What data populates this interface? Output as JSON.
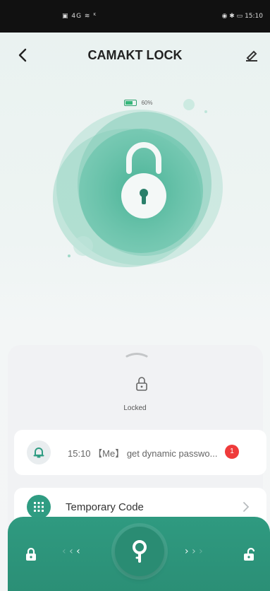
{
  "status_bar": {
    "left_icons": "▣ 4G ≋ ᴷ",
    "time": "15:10",
    "right_icons": "◉ ✱ ▭"
  },
  "header": {
    "title": "CAMAKT LOCK",
    "back_icon": "chevron-left-icon",
    "edit_icon": "pen-icon"
  },
  "battery": {
    "percent_label": "60%",
    "level": 0.6,
    "color": "#35b77a"
  },
  "lock_visual": {
    "icon": "padlock-icon",
    "accent": "#2f9c82"
  },
  "lock_status": {
    "label": "Locked",
    "icon": "small-lock-icon"
  },
  "notification": {
    "time": "15:10",
    "text": "15:10 【Me】 get dynamic passwo...",
    "badge_count": "1",
    "badge_color": "#ef3b3b"
  },
  "menu": {
    "temporary_code_label": "Temporary Code"
  },
  "bottom_bar": {
    "left_arrows": "‹ ‹ ‹",
    "right_arrows": "› › ›",
    "center_icon": "key-icon",
    "lock_icon": "lock-closed-icon",
    "unlock_icon": "lock-open-icon",
    "color": "#2f9a80"
  }
}
